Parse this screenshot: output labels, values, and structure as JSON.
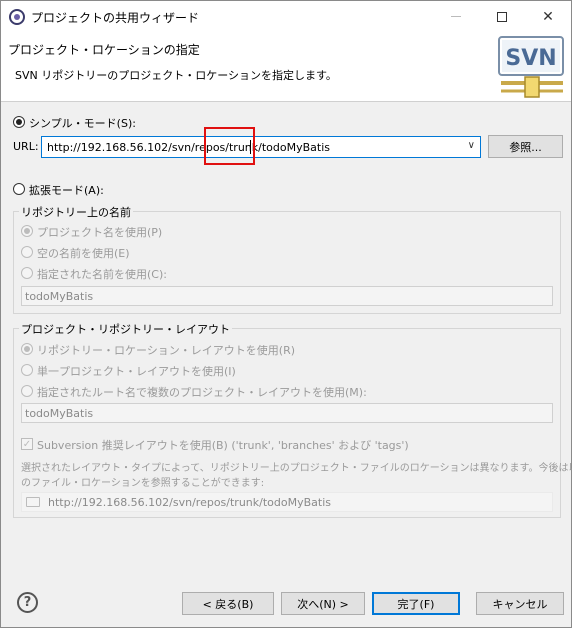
{
  "window": {
    "title": "プロジェクトの共用ウィザード",
    "minimize": "—",
    "maximize": "☐",
    "close": "✕"
  },
  "banner": {
    "title": "プロジェクト・ロケーションの指定",
    "description": "SVN リポジトリーのプロジェクト・ロケーションを指定します。",
    "logo_text": "SVN"
  },
  "simple_mode": {
    "label": "シンプル・モード(S):",
    "url_label": "URL:",
    "url_value": "http://192.168.56.102/svn/repos/trunk/todoMyBatis",
    "browse_button": "参照..."
  },
  "advanced_mode": {
    "label": "拡張モード(A):",
    "repo_name_group": {
      "legend": "リポジトリー上の名前",
      "options": [
        "プロジェクト名を使用(P)",
        "空の名前を使用(E)",
        "指定された名前を使用(C):"
      ],
      "name_field": "todoMyBatis"
    },
    "layout_group": {
      "legend": "プロジェクト・リポジトリー・レイアウト",
      "options": [
        "リポジトリー・ロケーション・レイアウトを使用(R)",
        "単一プロジェクト・レイアウトを使用(I)",
        "指定されたルート名で複数のプロジェクト・レイアウトを使用(M):"
      ],
      "root_field": "todoMyBatis",
      "subversion_checkbox": "Subversion 推奨レイアウトを使用(B) ('trunk', 'branches' および 'tags')",
      "note_line1": "選択されたレイアウト・タイプによって、リポジトリー上のプロジェクト・ファイルのロケーションは異なります。今後は以下",
      "note_line2": "のファイル・ロケーションを参照することができます:",
      "result_path": "http://192.168.56.102/svn/repos/trunk/todoMyBatis"
    }
  },
  "footer": {
    "help": "?",
    "back": "< 戻る(B)",
    "next": "次へ(N) >",
    "finish": "完了(F)",
    "cancel": "キャンセル"
  },
  "colors": {
    "highlight": "#e01010",
    "focus": "#0078d7"
  }
}
